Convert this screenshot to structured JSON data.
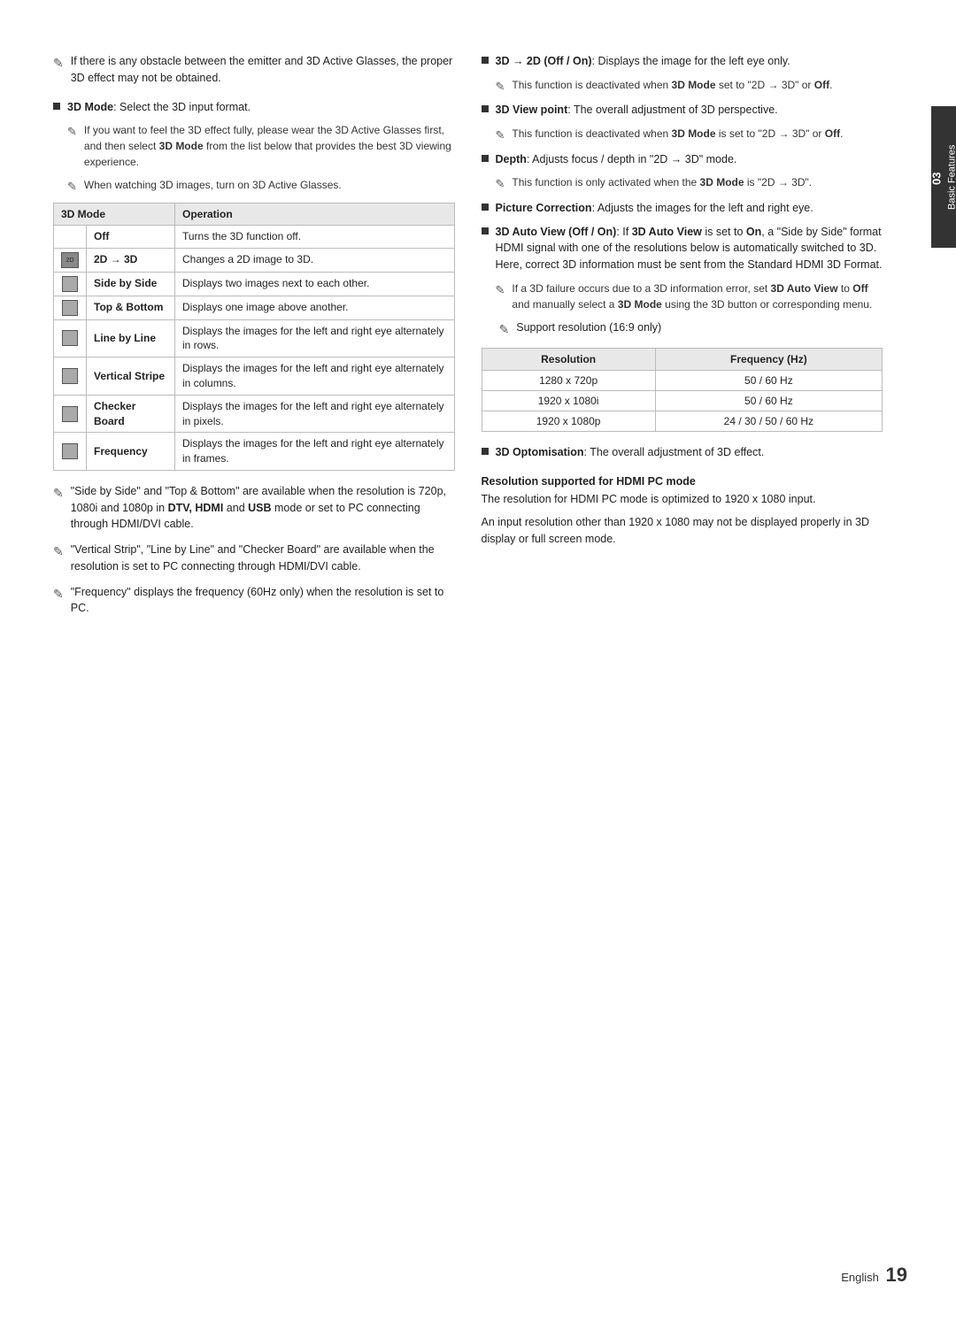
{
  "page": {
    "footer_lang": "English",
    "footer_page": "19",
    "chapter": "03",
    "chapter_title": "Basic Features"
  },
  "left_col": {
    "top_note": "If there is any obstacle between the emitter and 3D Active Glasses, the proper 3D effect may not be obtained.",
    "bullets": [
      {
        "id": "3d_mode_bullet",
        "label": "3D Mode",
        "text_before": ": Select the 3D input format.",
        "sub_notes": [
          "If you want to feel the 3D effect fully, please wear the 3D Active Glasses first, and then select 3D Mode from the list below that provides the best 3D viewing experience.",
          "When watching 3D images, turn on 3D Active Glasses."
        ]
      }
    ],
    "table": {
      "headers": [
        "3D Mode",
        "Operation"
      ],
      "rows": [
        {
          "icon": "",
          "mode": "Off",
          "operation": "Turns the 3D function off."
        },
        {
          "icon": "2D",
          "mode": "2D → 3D",
          "operation": "Changes a 2D image to 3D."
        },
        {
          "icon": "S",
          "mode": "Side by Side",
          "operation": "Displays two images next to each other."
        },
        {
          "icon": "T",
          "mode": "Top & Bottom",
          "operation": "Displays one image above another."
        },
        {
          "icon": "L",
          "mode": "Line by Line",
          "operation": "Displays the images for the left and right eye alternately in rows."
        },
        {
          "icon": "V",
          "mode": "Vertical Stripe",
          "operation": "Displays the images for the left and right eye alternately in columns."
        },
        {
          "icon": "C",
          "mode": "Checker Board",
          "operation": "Displays the images for the left and right eye alternately in pixels."
        },
        {
          "icon": "F",
          "mode": "Frequency",
          "operation": "Displays the images for the left and right eye alternately in frames."
        }
      ]
    },
    "bottom_notes": [
      "\"Side by Side\" and \"Top & Bottom\" are available when the resolution is 720p, 1080i and 1080p in DTV, HDMI and USB mode or set to PC connecting through HDMI/DVI cable.",
      "\"Vertical Strip\", \"Line by Line\" and \"Checker Board\" are available when the resolution is set to PC connecting through HDMI/DVI cable.",
      "\"Frequency\" displays the frequency (60Hz only) when the resolution is set to PC."
    ]
  },
  "right_col": {
    "bullets": [
      {
        "label": "3D → 2D (Off / On)",
        "text": ": Displays the image for the left eye only.",
        "sub_note": "This function is deactivated when 3D Mode set to \"2D → 3D\" or Off."
      },
      {
        "label": "3D View point",
        "text": ": The overall adjustment of 3D perspective.",
        "sub_note": "This function is deactivated when 3D Mode is set to \"2D → 3D\" or Off."
      },
      {
        "label": "Depth",
        "text": ": Adjusts focus / depth in \"2D → 3D\" mode.",
        "sub_note": "This function is only activated when the 3D Mode is \"2D → 3D\"."
      },
      {
        "label": "Picture Correction",
        "text": ": Adjusts the images for the left and right eye."
      },
      {
        "label": "3D Auto View (Off / On)",
        "text": ": If 3D Auto View is set to On, a \"Side by Side\" format HDMI signal with one of the resolutions below is automatically switched to 3D. Here, correct 3D information must be sent from the Standard HDMI 3D Format.",
        "sub_note": "If a 3D failure occurs due to a 3D information error, set 3D Auto View to Off and manually select a 3D Mode using the 3D button or corresponding menu."
      }
    ],
    "support_note": "Support resolution (16:9 only)",
    "res_table": {
      "headers": [
        "Resolution",
        "Frequency (Hz)"
      ],
      "rows": [
        {
          "res": "1280 x 720p",
          "freq": "50 / 60 Hz"
        },
        {
          "res": "1920 x 1080i",
          "freq": "50 / 60 Hz"
        },
        {
          "res": "1920 x 1080p",
          "freq": "24 / 30 / 50 / 60 Hz"
        }
      ]
    },
    "opt_bullet": {
      "label": "3D Optomisation",
      "text": ": The overall adjustment of 3D effect."
    },
    "hdmi_section": {
      "heading": "Resolution supported for HDMI PC mode",
      "para1": "The resolution for HDMI PC mode is optimized to 1920 x 1080 input.",
      "para2": "An input resolution other than 1920 x 1080 may not be displayed properly in 3D display or full screen mode."
    }
  }
}
